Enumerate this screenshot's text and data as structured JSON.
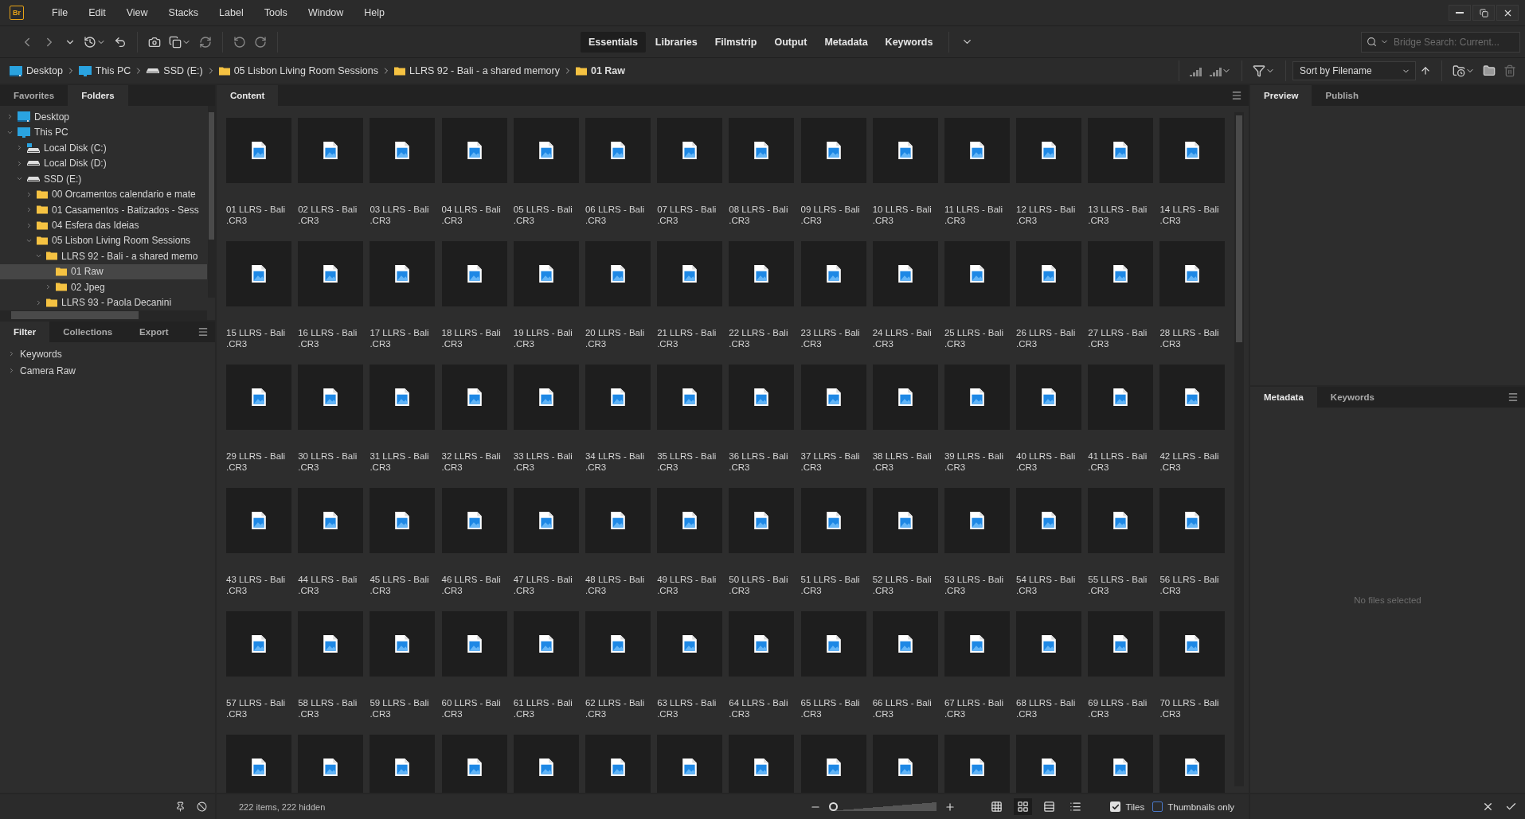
{
  "app_logo": "Br",
  "menu": [
    "File",
    "Edit",
    "View",
    "Stacks",
    "Label",
    "Tools",
    "Window",
    "Help"
  ],
  "workspaces": [
    {
      "label": "Essentials",
      "selected": true
    },
    {
      "label": "Libraries",
      "selected": false
    },
    {
      "label": "Filmstrip",
      "selected": false
    },
    {
      "label": "Output",
      "selected": false
    },
    {
      "label": "Metadata",
      "selected": false
    },
    {
      "label": "Keywords",
      "selected": false
    }
  ],
  "search": {
    "placeholder": "Bridge Search: Current..."
  },
  "breadcrumbs": [
    {
      "label": "Desktop",
      "kind": "desktop",
      "current": false
    },
    {
      "label": "This PC",
      "kind": "pc",
      "current": false
    },
    {
      "label": "SSD (E:)",
      "kind": "disk",
      "current": false
    },
    {
      "label": "05 Lisbon Living Room Sessions",
      "kind": "folder",
      "current": false
    },
    {
      "label": "LLRS 92 - Bali - a shared memory",
      "kind": "folder",
      "current": false
    },
    {
      "label": "01 Raw",
      "kind": "folder",
      "current": true
    }
  ],
  "sort": {
    "value": "Sort by Filename"
  },
  "left_tabs": [
    {
      "label": "Favorites",
      "selected": false
    },
    {
      "label": "Folders",
      "selected": true
    }
  ],
  "folders": [
    {
      "label": "Desktop",
      "kind": "desktop",
      "expanded": false,
      "selected": false
    },
    {
      "label": "This PC",
      "kind": "pc",
      "expanded": true,
      "selected": false,
      "children": [
        {
          "label": "Local Disk (C:)",
          "kind": "system-disk",
          "expanded": false,
          "selected": false
        },
        {
          "label": "Local Disk (D:)",
          "kind": "disk",
          "expanded": false,
          "selected": false
        },
        {
          "label": "SSD (E:)",
          "kind": "disk",
          "expanded": true,
          "selected": false,
          "children": [
            {
              "label": "00 Orcamentos calendario e mate",
              "kind": "folder",
              "expanded": false,
              "selected": false
            },
            {
              "label": "01 Casamentos - Batizados - Sess",
              "kind": "folder",
              "expanded": false,
              "selected": false
            },
            {
              "label": "04 Esfera das Ideias",
              "kind": "folder",
              "expanded": false,
              "selected": false
            },
            {
              "label": "05 Lisbon Living Room Sessions",
              "kind": "folder",
              "expanded": true,
              "selected": false,
              "children": [
                {
                  "label": "LLRS 92 - Bali - a shared memo",
                  "kind": "folder",
                  "expanded": true,
                  "selected": false,
                  "children": [
                    {
                      "label": "01 Raw",
                      "kind": "folder",
                      "selected": true
                    },
                    {
                      "label": "02 Jpeg",
                      "kind": "folder",
                      "expanded": false,
                      "selected": false
                    }
                  ]
                },
                {
                  "label": "LLRS 93 - Paola Decanini",
                  "kind": "folder",
                  "expanded": false,
                  "selected": false
                }
              ]
            }
          ]
        }
      ]
    }
  ],
  "filter_tabs": [
    {
      "label": "Filter",
      "selected": true
    },
    {
      "label": "Collections",
      "selected": false
    },
    {
      "label": "Export",
      "selected": false
    }
  ],
  "filter_sections": [
    "Keywords",
    "Camera Raw"
  ],
  "content_tab": "Content",
  "files": [
    {
      "kind": "tile",
      "name": "01 LLRS - Bali",
      "ext": ".CR3"
    },
    {
      "kind": "tile",
      "name": "02 LLRS - Bali",
      "ext": ".CR3"
    },
    {
      "kind": "tile",
      "name": "03 LLRS - Bali",
      "ext": ".CR3"
    },
    {
      "kind": "tile",
      "name": "04 LLRS - Bali",
      "ext": ".CR3"
    },
    {
      "kind": "tile",
      "name": "05 LLRS - Bali",
      "ext": ".CR3"
    },
    {
      "kind": "tile",
      "name": "06 LLRS - Bali",
      "ext": ".CR3"
    },
    {
      "kind": "tile",
      "name": "07 LLRS - Bali",
      "ext": ".CR3"
    },
    {
      "kind": "tile",
      "name": "08 LLRS - Bali",
      "ext": ".CR3"
    },
    {
      "kind": "tile",
      "name": "09 LLRS - Bali",
      "ext": ".CR3"
    },
    {
      "kind": "tile",
      "name": "10 LLRS - Bali",
      "ext": ".CR3"
    },
    {
      "kind": "tile",
      "name": "11 LLRS - Bali",
      "ext": ".CR3"
    },
    {
      "kind": "tile",
      "name": "12 LLRS - Bali",
      "ext": ".CR3"
    },
    {
      "kind": "tile",
      "name": "13 LLRS - Bali",
      "ext": ".CR3"
    },
    {
      "kind": "tile",
      "name": "14 LLRS - Bali",
      "ext": ".CR3"
    },
    {
      "kind": "tile",
      "name": "15 LLRS - Bali",
      "ext": ".CR3"
    },
    {
      "kind": "tile",
      "name": "16 LLRS - Bali",
      "ext": ".CR3"
    },
    {
      "kind": "tile",
      "name": "17 LLRS - Bali",
      "ext": ".CR3"
    },
    {
      "kind": "tile",
      "name": "18 LLRS - Bali",
      "ext": ".CR3"
    },
    {
      "kind": "tile",
      "name": "19 LLRS - Bali",
      "ext": ".CR3"
    },
    {
      "kind": "tile",
      "name": "20 LLRS - Bali",
      "ext": ".CR3"
    },
    {
      "kind": "tile",
      "name": "21 LLRS - Bali",
      "ext": ".CR3"
    },
    {
      "kind": "tile",
      "name": "22 LLRS - Bali",
      "ext": ".CR3"
    },
    {
      "kind": "tile",
      "name": "23 LLRS - Bali",
      "ext": ".CR3"
    },
    {
      "kind": "tile",
      "name": "24 LLRS - Bali",
      "ext": ".CR3"
    },
    {
      "kind": "tile",
      "name": "25 LLRS - Bali",
      "ext": ".CR3"
    },
    {
      "kind": "tile",
      "name": "26 LLRS - Bali",
      "ext": ".CR3"
    },
    {
      "kind": "tile",
      "name": "27 LLRS - Bali",
      "ext": ".CR3"
    },
    {
      "kind": "tile",
      "name": "28 LLRS - Bali",
      "ext": ".CR3"
    },
    {
      "kind": "tile",
      "name": "29 LLRS - Bali",
      "ext": ".CR3"
    },
    {
      "kind": "tile",
      "name": "30 LLRS - Bali",
      "ext": ".CR3"
    },
    {
      "kind": "tile",
      "name": "31 LLRS - Bali",
      "ext": ".CR3"
    },
    {
      "kind": "tile",
      "name": "32 LLRS - Bali",
      "ext": ".CR3"
    },
    {
      "kind": "tile",
      "name": "33 LLRS - Bali",
      "ext": ".CR3"
    },
    {
      "kind": "tile",
      "name": "34 LLRS - Bali",
      "ext": ".CR3"
    },
    {
      "kind": "tile",
      "name": "35 LLRS - Bali",
      "ext": ".CR3"
    },
    {
      "kind": "tile",
      "name": "36 LLRS - Bali",
      "ext": ".CR3"
    },
    {
      "kind": "tile",
      "name": "37 LLRS - Bali",
      "ext": ".CR3"
    },
    {
      "kind": "tile",
      "name": "38 LLRS - Bali",
      "ext": ".CR3"
    },
    {
      "kind": "tile",
      "name": "39 LLRS - Bali",
      "ext": ".CR3"
    },
    {
      "kind": "tile",
      "name": "40 LLRS - Bali",
      "ext": ".CR3"
    },
    {
      "kind": "tile",
      "name": "41 LLRS - Bali",
      "ext": ".CR3"
    },
    {
      "kind": "tile",
      "name": "42 LLRS - Bali",
      "ext": ".CR3"
    },
    {
      "kind": "tile",
      "name": "43 LLRS - Bali",
      "ext": ".CR3"
    },
    {
      "kind": "tile",
      "name": "44 LLRS - Bali",
      "ext": ".CR3"
    },
    {
      "kind": "tile",
      "name": "45 LLRS - Bali",
      "ext": ".CR3"
    },
    {
      "kind": "tile",
      "name": "46 LLRS - Bali",
      "ext": ".CR3"
    },
    {
      "kind": "tile",
      "name": "47 LLRS - Bali",
      "ext": ".CR3"
    },
    {
      "kind": "tile",
      "name": "48 LLRS - Bali",
      "ext": ".CR3"
    },
    {
      "kind": "tile",
      "name": "49 LLRS - Bali",
      "ext": ".CR3"
    },
    {
      "kind": "tile",
      "name": "50 LLRS - Bali",
      "ext": ".CR3"
    },
    {
      "kind": "tile",
      "name": "51 LLRS - Bali",
      "ext": ".CR3"
    },
    {
      "kind": "tile",
      "name": "52 LLRS - Bali",
      "ext": ".CR3"
    },
    {
      "kind": "tile",
      "name": "53 LLRS - Bali",
      "ext": ".CR3"
    },
    {
      "kind": "tile",
      "name": "54 LLRS - Bali",
      "ext": ".CR3"
    },
    {
      "kind": "tile",
      "name": "55 LLRS - Bali",
      "ext": ".CR3"
    },
    {
      "kind": "tile",
      "name": "56 LLRS - Bali",
      "ext": ".CR3"
    },
    {
      "kind": "tile",
      "name": "57 LLRS - Bali",
      "ext": ".CR3"
    },
    {
      "kind": "tile",
      "name": "58 LLRS - Bali",
      "ext": ".CR3"
    },
    {
      "kind": "tile",
      "name": "59 LLRS - Bali",
      "ext": ".CR3"
    },
    {
      "kind": "tile",
      "name": "60 LLRS - Bali",
      "ext": ".CR3"
    },
    {
      "kind": "tile",
      "name": "61 LLRS - Bali",
      "ext": ".CR3"
    },
    {
      "kind": "tile",
      "name": "62 LLRS - Bali",
      "ext": ".CR3"
    },
    {
      "kind": "tile",
      "name": "63 LLRS - Bali",
      "ext": ".CR3"
    },
    {
      "kind": "tile",
      "name": "64 LLRS - Bali",
      "ext": ".CR3"
    },
    {
      "kind": "tile",
      "name": "65 LLRS - Bali",
      "ext": ".CR3"
    },
    {
      "kind": "tile",
      "name": "66 LLRS - Bali",
      "ext": ".CR3"
    },
    {
      "kind": "tile",
      "name": "67 LLRS - Bali",
      "ext": ".CR3"
    },
    {
      "kind": "tile",
      "name": "68 LLRS - Bali",
      "ext": ".CR3"
    },
    {
      "kind": "tile",
      "name": "69 LLRS - Bali",
      "ext": ".CR3"
    },
    {
      "kind": "tile",
      "name": "70 LLRS - Bali",
      "ext": ".CR3"
    },
    {
      "kind": "clipped"
    },
    {
      "kind": "clipped"
    },
    {
      "kind": "clipped"
    },
    {
      "kind": "clipped"
    },
    {
      "kind": "clipped"
    },
    {
      "kind": "clipped"
    },
    {
      "kind": "clipped"
    },
    {
      "kind": "clipped"
    },
    {
      "kind": "clipped"
    },
    {
      "kind": "clipped"
    },
    {
      "kind": "clipped"
    },
    {
      "kind": "clipped"
    },
    {
      "kind": "clipped"
    },
    {
      "kind": "clipped"
    }
  ],
  "preview_tabs": [
    {
      "label": "Preview",
      "selected": true
    },
    {
      "label": "Publish",
      "selected": false
    }
  ],
  "metadata_tabs": [
    {
      "label": "Metadata",
      "selected": true
    },
    {
      "label": "Keywords",
      "selected": false
    }
  ],
  "metadata_empty": "No files selected",
  "status": {
    "items": "222 items, 222 hidden",
    "zoom": {
      "level": 0.0
    },
    "views": [
      {
        "kind": "grid",
        "selected": false
      },
      {
        "kind": "thumbs",
        "selected": true
      },
      {
        "kind": "details",
        "selected": false
      },
      {
        "kind": "list",
        "selected": false
      }
    ],
    "options": [
      {
        "label": "Tiles",
        "checked": true
      },
      {
        "label": "Thumbnails only",
        "checked": false
      }
    ]
  }
}
